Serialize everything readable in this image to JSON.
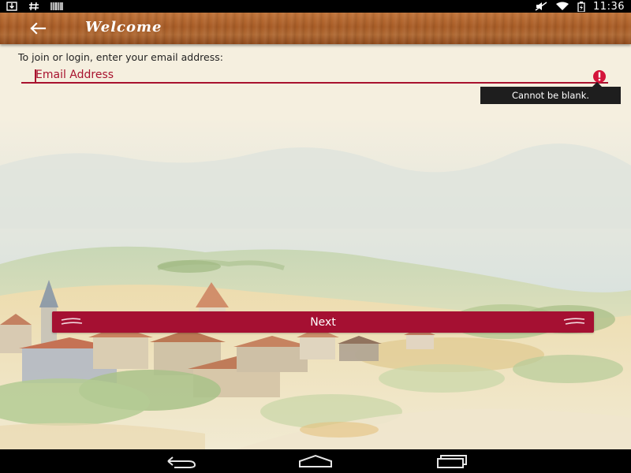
{
  "status_bar": {
    "time": "11:36",
    "left_icons": [
      "download-icon",
      "hash-icon",
      "barcode-icon"
    ],
    "right_icons": [
      "mute-icon",
      "wifi-icon",
      "battery-charging-icon"
    ]
  },
  "toolbar": {
    "title": "Welcome",
    "back_icon": "arrow-back-icon"
  },
  "form": {
    "prompt": "To join or login, enter your email address:",
    "email": {
      "value": "",
      "placeholder": "Email Address",
      "error": "Cannot be blank."
    },
    "next_label": "Next"
  },
  "nav_bar": {
    "icons": [
      "back-nav-icon",
      "home-nav-icon",
      "recents-nav-icon"
    ]
  },
  "colors": {
    "accent": "#a8122e",
    "button": "#a51032",
    "background": "#f5efdf",
    "toolbar_wood": "#a85c26"
  }
}
